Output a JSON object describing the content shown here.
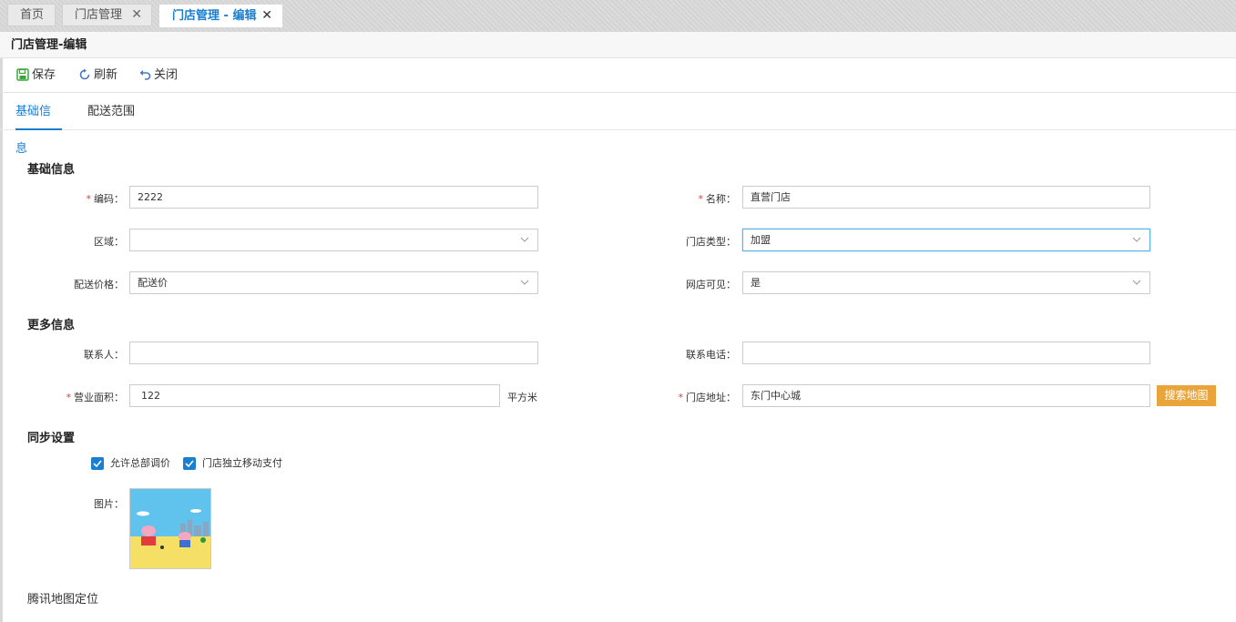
{
  "tabs": [
    {
      "label": "首页"
    },
    {
      "label": "门店管理"
    },
    {
      "label": "门店管理 - 编辑"
    }
  ],
  "page_title": "门店管理-编辑",
  "toolbar": {
    "save": "保存",
    "refresh": "刷新",
    "close": "关闭"
  },
  "subtabs": [
    {
      "label": "基础信息"
    },
    {
      "label": "配送范围"
    }
  ],
  "sections": {
    "basic": "基础信息",
    "more": "更多信息",
    "sync": "同步设置",
    "map": "腾讯地图定位"
  },
  "fields": {
    "code": {
      "label": "编码：",
      "value": "2222",
      "required": true
    },
    "name": {
      "label": "名称：",
      "value": "直营门店",
      "required": true
    },
    "region": {
      "label": "区域：",
      "value": ""
    },
    "store_type": {
      "label": "门店类型：",
      "value": "加盟"
    },
    "delivery_price": {
      "label": "配送价格：",
      "value": "配送价"
    },
    "online_visible": {
      "label": "网店可见：",
      "value": "是"
    },
    "contact": {
      "label": "联系人：",
      "value": ""
    },
    "phone": {
      "label": "联系电话：",
      "value": ""
    },
    "area": {
      "label": "营业面积：",
      "value": "122",
      "unit": "平方米",
      "required": true
    },
    "address": {
      "label": "门店地址：",
      "value": "东门中心城",
      "required": true
    },
    "picture": {
      "label": "图片："
    }
  },
  "search_map_button": "搜索地图",
  "checkboxes": [
    {
      "label": "允许总部调价",
      "checked": true
    },
    {
      "label": "门店独立移动支付",
      "checked": true
    }
  ],
  "colors": {
    "accent": "#1a7fd0",
    "required": "#e33333",
    "map_button": "#e9a53a"
  }
}
